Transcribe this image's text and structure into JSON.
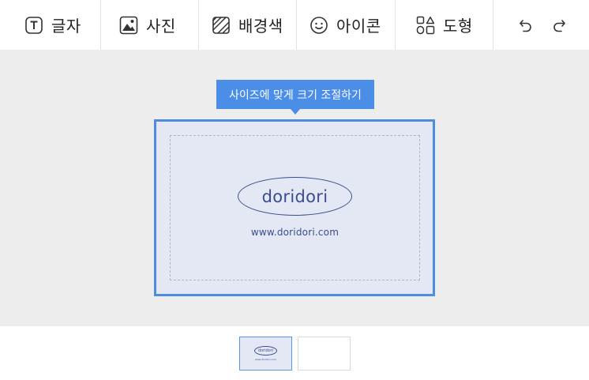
{
  "toolbar": {
    "tools": [
      {
        "label": "글자",
        "icon": "text-icon"
      },
      {
        "label": "사진",
        "icon": "photo-icon"
      },
      {
        "label": "배경색",
        "icon": "background-pattern-icon"
      },
      {
        "label": "아이콘",
        "icon": "smiley-icon"
      },
      {
        "label": "도형",
        "icon": "shapes-icon"
      }
    ],
    "undo_icon": "undo-icon",
    "redo_icon": "redo-icon"
  },
  "editor": {
    "tooltip": "사이즈에 맞게 크기 조절하기",
    "card": {
      "logo": "doridori",
      "website": "www.doridori.com"
    }
  },
  "thumbnails": [
    {
      "logo": "doridori",
      "website": "www.doridori.com",
      "selected": true
    },
    {
      "selected": false
    }
  ],
  "colors": {
    "accent": "#4b8ee8",
    "card_background": "#e3e8f4",
    "card_text": "#3a4d8f",
    "canvas_background": "#ededed"
  }
}
